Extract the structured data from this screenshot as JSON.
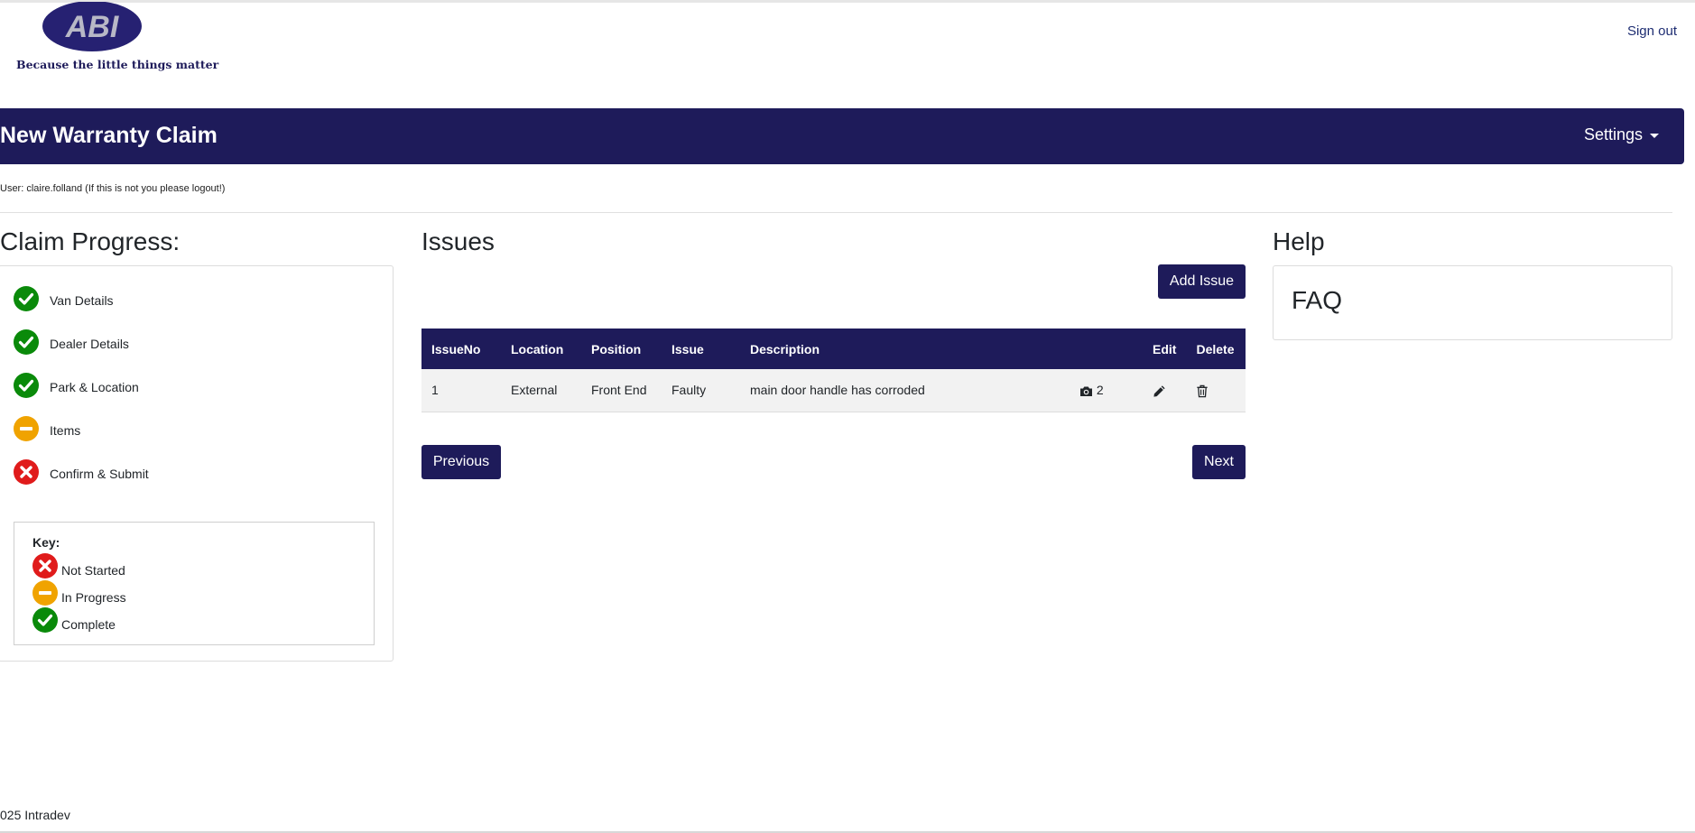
{
  "header": {
    "logo_text": "ABI",
    "tagline": "Because the little things matter",
    "sign_out": "Sign out"
  },
  "banner": {
    "title": "New Warranty Claim",
    "settings_label": "Settings"
  },
  "user_line": "User: claire.folland (If this is not you please logout!)",
  "progress": {
    "title": "Claim Progress:",
    "items": [
      {
        "label": "Van Details",
        "status": "complete"
      },
      {
        "label": "Dealer Details",
        "status": "complete"
      },
      {
        "label": "Park & Location",
        "status": "complete"
      },
      {
        "label": "Items",
        "status": "in-progress"
      },
      {
        "label": "Confirm & Submit",
        "status": "not-started"
      }
    ],
    "key": {
      "title": "Key:",
      "items": [
        {
          "label": "Not Started",
          "status": "not-started"
        },
        {
          "label": "In Progress",
          "status": "in-progress"
        },
        {
          "label": "Complete",
          "status": "complete"
        }
      ]
    }
  },
  "issues": {
    "title": "Issues",
    "add_button": "Add Issue",
    "columns": [
      "IssueNo",
      "Location",
      "Position",
      "Issue",
      "Description",
      "",
      "Edit",
      "Delete"
    ],
    "rows": [
      {
        "issue_no": "1",
        "location": "External",
        "position": "Front End",
        "issue": "Faulty",
        "description": "main door handle has corroded",
        "photo_count": "2"
      }
    ],
    "previous_button": "Previous",
    "next_button": "Next"
  },
  "help": {
    "title": "Help",
    "faq": "FAQ"
  },
  "footer": {
    "text": "025 Intradev"
  },
  "colors": {
    "primary": "#1e1b5a",
    "complete": "#0a8a0a",
    "in_progress": "#f0a300",
    "not_started": "#e01b1b"
  }
}
